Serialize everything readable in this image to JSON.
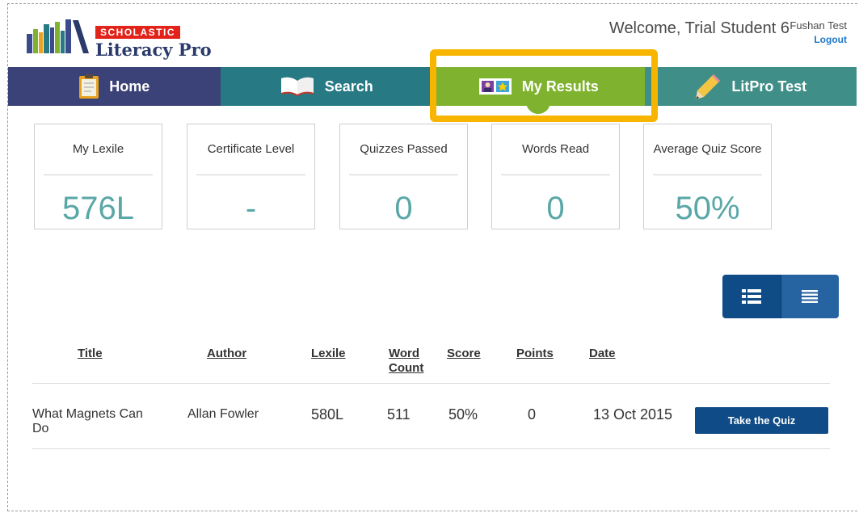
{
  "header": {
    "brand_badge": "SCHOLASTIC",
    "brand_name": "Literacy Pro",
    "welcome": "Welcome, Trial Student 6",
    "school": "Fushan Test",
    "logout": "Logout"
  },
  "nav": [
    {
      "label": "Home",
      "icon": "clipboard-icon"
    },
    {
      "label": "Search",
      "icon": "open-book-icon"
    },
    {
      "label": "My Results",
      "icon": "id-card-star-icon",
      "active": true
    },
    {
      "label": "LitPro Test",
      "icon": "pencil-icon"
    }
  ],
  "stats": [
    {
      "label": "My Lexile",
      "value": "576L"
    },
    {
      "label": "Certificate Level",
      "value": "-"
    },
    {
      "label": "Quizzes Passed",
      "value": "0"
    },
    {
      "label": "Words Read",
      "value": "0"
    },
    {
      "label": "Average Quiz Score",
      "value": "50%"
    }
  ],
  "table": {
    "columns": [
      "Title",
      "Author",
      "Lexile",
      "Word Count",
      "Score",
      "Points",
      "Date"
    ],
    "rows": [
      {
        "title": "What Magnets Can Do",
        "author": "Allan Fowler",
        "lexile": "580L",
        "word_count": "511",
        "score": "50%",
        "points": "0",
        "date": "13 Oct 2015",
        "action": "Take the Quiz"
      }
    ]
  },
  "colors": {
    "nav_home": "#3a4277",
    "nav_search": "#277a84",
    "nav_results": "#7fb22e",
    "nav_litpro": "#3f8f88",
    "highlight": "#f7b500",
    "button_blue": "#0f4b86",
    "stat_value": "#5aa7a7"
  }
}
